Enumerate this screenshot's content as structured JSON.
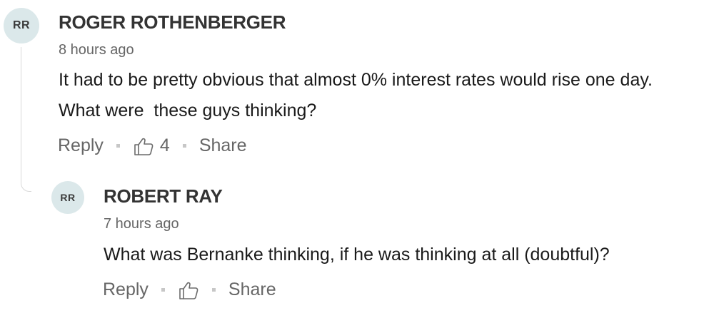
{
  "comments": [
    {
      "avatar_initials": "RR",
      "author": "ROGER ROTHENBERGER",
      "timestamp": "8 hours ago",
      "body_line_1": "It had to be pretty obvious that almost 0% interest rates would rise one day.",
      "body_line_2": "What were  these guys thinking?",
      "reply_label": "Reply",
      "like_count": "4",
      "share_label": "Share",
      "like_icon": "thumbs-up-icon"
    },
    {
      "avatar_initials": "RR",
      "author": "ROBERT RAY",
      "timestamp": "7 hours ago",
      "body_line_1": "What was Bernanke thinking, if he was thinking at all (doubtful)?",
      "reply_label": "Reply",
      "like_count": "",
      "share_label": "Share",
      "like_icon": "thumbs-up-icon"
    }
  ],
  "colors": {
    "avatar_bg": "#dbe8ea",
    "author_text": "#333333",
    "meta_text": "#666666",
    "thread_line": "#d9d9d9"
  }
}
